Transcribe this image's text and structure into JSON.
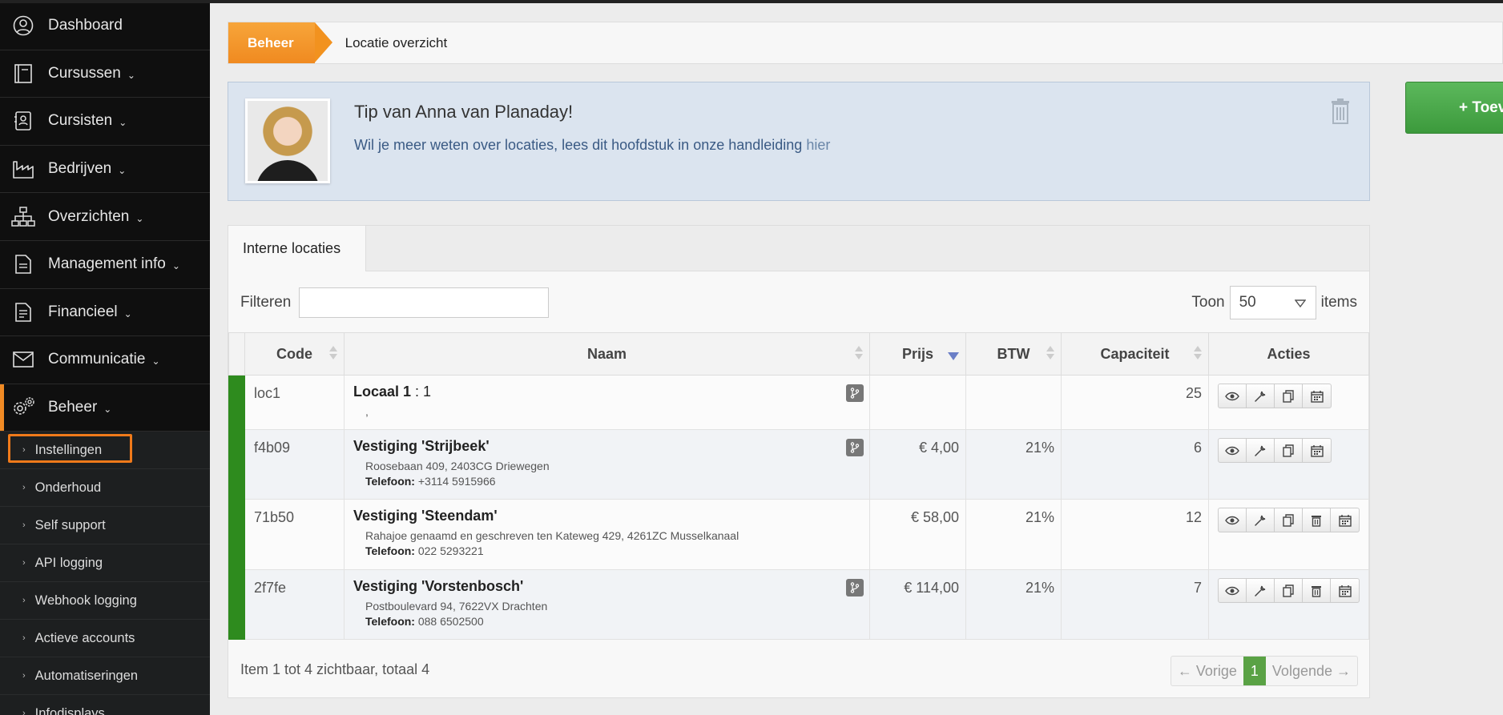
{
  "sidebar": {
    "items": [
      {
        "label": "Dashboard",
        "icon": "user-circle-icon",
        "has_chevron": false
      },
      {
        "label": "Cursussen",
        "icon": "book-icon",
        "has_chevron": true
      },
      {
        "label": "Cursisten",
        "icon": "contact-card-icon",
        "has_chevron": true
      },
      {
        "label": "Bedrijven",
        "icon": "factory-icon",
        "has_chevron": true
      },
      {
        "label": "Overzichten",
        "icon": "sitemap-icon",
        "has_chevron": true
      },
      {
        "label": "Management info",
        "icon": "document-icon",
        "has_chevron": true
      },
      {
        "label": "Financieel",
        "icon": "invoice-icon",
        "has_chevron": true
      },
      {
        "label": "Communicatie",
        "icon": "envelope-icon",
        "has_chevron": true
      },
      {
        "label": "Beheer",
        "icon": "gears-icon",
        "has_chevron": true
      }
    ],
    "chevron": "⌄",
    "submenu": [
      {
        "label": "Instellingen"
      },
      {
        "label": "Onderhoud"
      },
      {
        "label": "Self support"
      },
      {
        "label": "API logging"
      },
      {
        "label": "Webhook logging"
      },
      {
        "label": "Actieve accounts"
      },
      {
        "label": "Automatiseringen"
      },
      {
        "label": "Infodisplays"
      }
    ],
    "submenu_arrow": "›"
  },
  "breadcrumb": {
    "home": "Beheer",
    "current": "Locatie overzicht"
  },
  "tip": {
    "title": "Tip van Anna van Planaday!",
    "text": "Wil je meer weten over locaties, lees dit hoofdstuk in onze handleiding",
    "link": "hier"
  },
  "add_button": {
    "label": "+ Toev"
  },
  "panel": {
    "tab": "Interne locaties",
    "filter_label": "Filteren",
    "filter_value": "",
    "toon_label": "Toon",
    "toon_value": "50",
    "items_label": "items"
  },
  "table": {
    "headers": [
      "Code",
      "Naam",
      "Prijs",
      "BTW",
      "Capaciteit",
      "Acties"
    ],
    "rows": [
      {
        "code": "loc1",
        "name": "Locaal 1",
        "suffix": " : 1",
        "address": ",",
        "tel_label": "",
        "tel": "",
        "price": "",
        "btw": "",
        "capacity": "25",
        "has_branch": true,
        "has_delete": false
      },
      {
        "code": "f4b09",
        "name": "Vestiging 'Strijbeek'",
        "suffix": "",
        "address": "Roosebaan 409, 2403CG Driewegen",
        "tel_label": "Telefoon:",
        "tel": "+3114 5915966",
        "price": "€ 4,00",
        "btw": "21%",
        "capacity": "6",
        "has_branch": true,
        "has_delete": false
      },
      {
        "code": "71b50",
        "name": "Vestiging 'Steendam'",
        "suffix": "",
        "address": "Rahajoe genaamd en geschreven ten Kateweg 429, 4261ZC Musselkanaal",
        "tel_label": "Telefoon:",
        "tel": "022 5293221",
        "price": "€ 58,00",
        "btw": "21%",
        "capacity": "12",
        "has_branch": false,
        "has_delete": true
      },
      {
        "code": "2f7fe",
        "name": "Vestiging 'Vorstenbosch'",
        "suffix": "",
        "address": "Postboulevard 94, 7622VX Drachten",
        "tel_label": "Telefoon:",
        "tel": "088 6502500",
        "price": "€ 114,00",
        "btw": "21%",
        "capacity": "7",
        "has_branch": true,
        "has_delete": true
      }
    ]
  },
  "footer": {
    "summary": "Item 1 tot 4 zichtbaar, totaal 4",
    "prev": "← Vorige",
    "page": "1",
    "next": "Volgende →"
  },
  "colors": {
    "accent": "#f08a24",
    "active_strip": "#2e8b1e",
    "tip_bg": "#dbe4ef",
    "add_button": "#4cae4c"
  }
}
